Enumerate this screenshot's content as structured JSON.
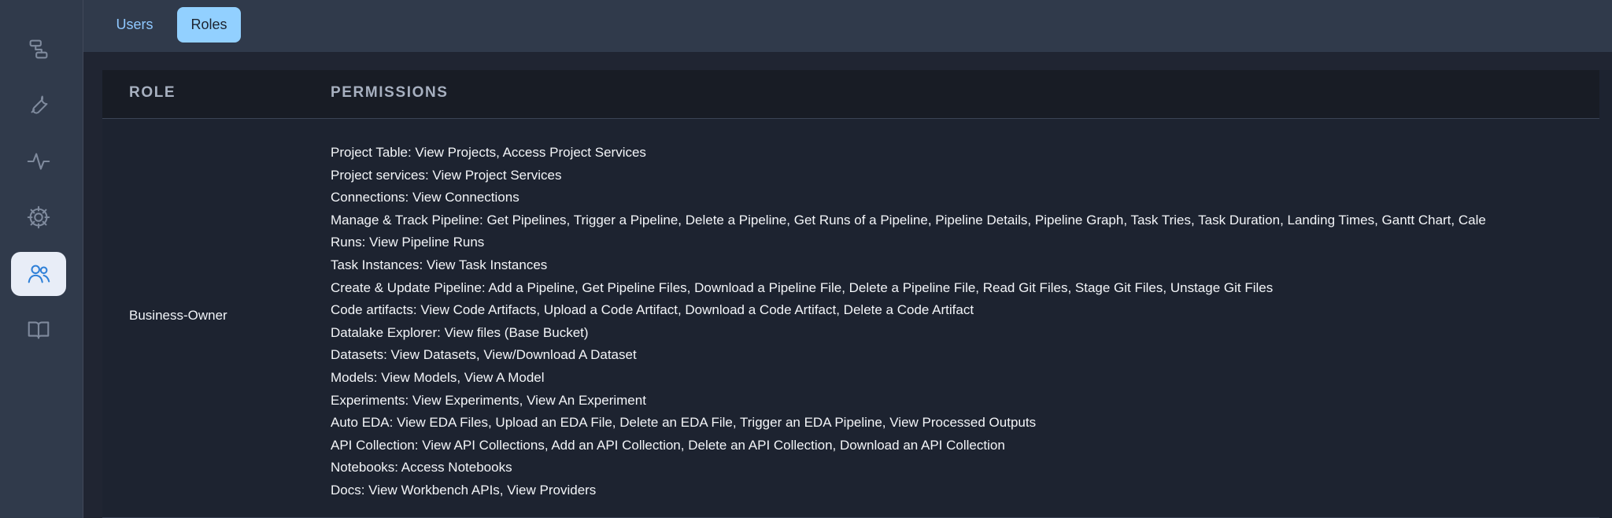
{
  "sidebar": {
    "items": [
      {
        "icon": "flow-icon"
      },
      {
        "icon": "wrench-icon"
      },
      {
        "icon": "activity-icon"
      },
      {
        "icon": "gear-icon"
      },
      {
        "icon": "users-icon",
        "active": true
      },
      {
        "icon": "book-icon"
      }
    ]
  },
  "tabs": {
    "users": "Users",
    "roles": "Roles",
    "active": "Roles"
  },
  "table": {
    "headers": {
      "role": "ROLE",
      "permissions": "PERMISSIONS"
    },
    "rows": [
      {
        "role": "Business-Owner",
        "permissions": [
          "Project Table: View Projects, Access Project Services",
          "Project services: View Project Services",
          "Connections: View Connections",
          "Manage & Track Pipeline: Get Pipelines, Trigger a Pipeline, Delete a Pipeline, Get Runs of a Pipeline, Pipeline Details, Pipeline Graph, Task Tries, Task Duration, Landing Times, Gantt Chart, Cale",
          "Runs: View Pipeline Runs",
          "Task Instances: View Task Instances",
          "Create & Update Pipeline: Add a Pipeline, Get Pipeline Files, Download a Pipeline File, Delete a Pipeline File, Read Git Files, Stage Git Files, Unstage Git Files",
          "Code artifacts: View Code Artifacts, Upload a Code Artifact, Download a Code Artifact, Delete a Code Artifact",
          "Datalake Explorer: View files (Base Bucket)",
          "Datasets: View Datasets, View/Download A Dataset",
          "Models: View Models, View A Model",
          "Experiments: View Experiments, View An Experiment",
          "Auto EDA: View EDA Files, Upload an EDA File, Delete an EDA File, Trigger an EDA Pipeline, View Processed Outputs",
          "API Collection: View API Collections, Add an API Collection, Delete an API Collection, Download an API Collection",
          "Notebooks: Access Notebooks",
          "Docs: View Workbench APIs, View Providers"
        ]
      }
    ]
  },
  "colors": {
    "sidebar_bg": "#303a4b",
    "content_bg": "#1d2330",
    "header_bg": "#181c25",
    "active_tab": "#92d0ff",
    "accent": "#2f80d8",
    "text": "#f3f5f8"
  }
}
